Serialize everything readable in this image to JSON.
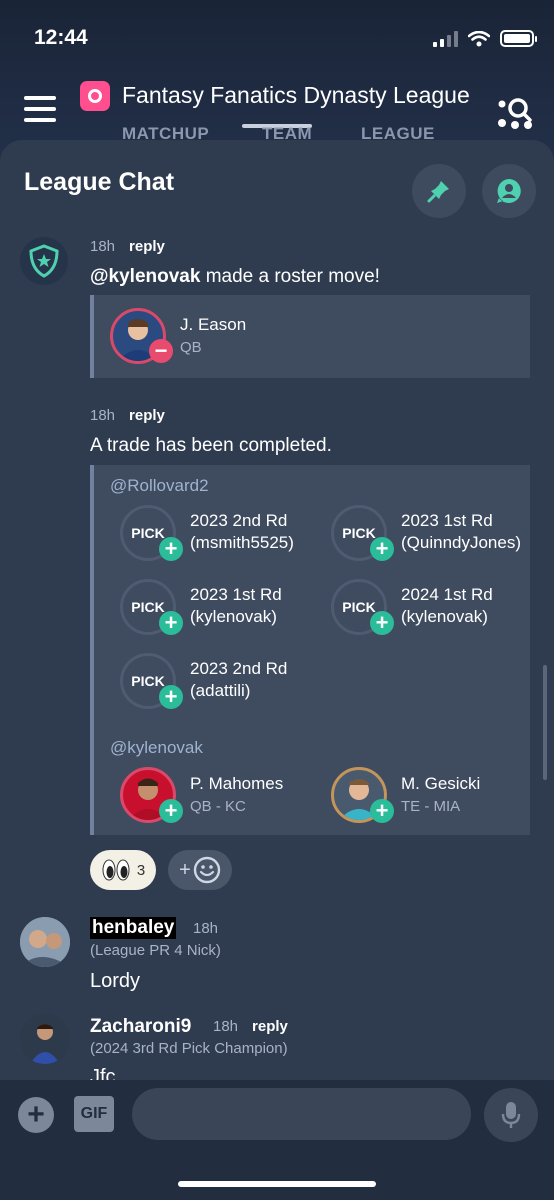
{
  "status_bar": {
    "time": "12:44"
  },
  "header": {
    "league_title": "Fantasy Fanatics Dynasty League",
    "tabs": [
      {
        "label": "MATCHUP"
      },
      {
        "label": "TEAM"
      },
      {
        "label": "LEAGUE"
      }
    ]
  },
  "chat": {
    "title": "League Chat",
    "messages": [
      {
        "time": "18h",
        "reply": "reply",
        "mention": "@kylenovak",
        "text": " made a roster move!",
        "player": {
          "name": "J. Eason",
          "pos": "QB"
        }
      },
      {
        "time": "18h",
        "reply": "reply",
        "text": "A trade has been completed.",
        "side1_user": "@Rollovard2",
        "picks": [
          {
            "label": "PICK",
            "line1": "2023 2nd Rd",
            "line2": "(msmith5525)"
          },
          {
            "label": "PICK",
            "line1": "2023 1st Rd",
            "line2": "(QuinndyJones)"
          },
          {
            "label": "PICK",
            "line1": "2023 1st Rd",
            "line2": "(kylenovak)"
          },
          {
            "label": "PICK",
            "line1": "2024 1st Rd",
            "line2": "(kylenovak)"
          },
          {
            "label": "PICK",
            "line1": "2023 2nd Rd",
            "line2": "(adattili)"
          }
        ],
        "side2_user": "@kylenovak",
        "players": [
          {
            "name": "P. Mahomes",
            "pos": "QB - KC"
          },
          {
            "name": "M. Gesicki",
            "pos": "TE - MIA"
          }
        ],
        "reaction_count": "3"
      },
      {
        "user": "henbaley",
        "time": "18h",
        "subtitle": "(League PR 4 Nick)",
        "text": "Lordy"
      },
      {
        "user": "Zacharoni9",
        "time": "18h",
        "reply": "reply",
        "subtitle": "(2024 3rd Rd Pick Champion)",
        "text": "Jfc"
      }
    ]
  },
  "composer": {
    "gif_label": "GIF"
  },
  "colors": {
    "accent": "#2bbd9a",
    "remove": "#e94b6f",
    "brand": "#ff4f8e"
  }
}
